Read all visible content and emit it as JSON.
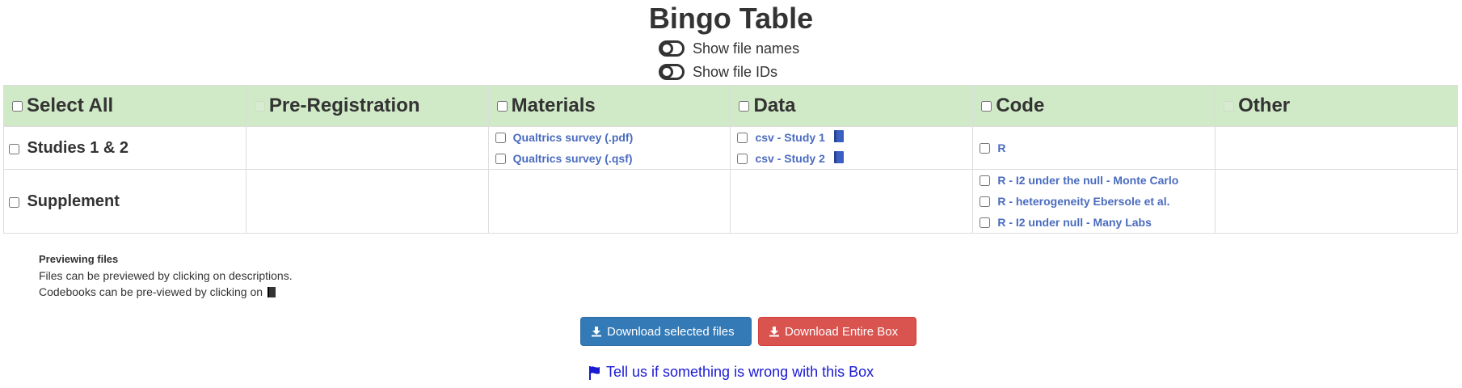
{
  "title": "Bingo Table",
  "toggles": {
    "show_file_names": "Show file names",
    "show_file_ids": "Show file IDs"
  },
  "table": {
    "headers": [
      "Select All",
      "Pre-Registration",
      "Materials",
      "Data",
      "Code",
      "Other"
    ],
    "rows": [
      {
        "label": "Studies 1 & 2",
        "materials": [
          "Qualtrics survey (.pdf)",
          "Qualtrics survey (.qsf)"
        ],
        "data": [
          "csv - Study 1",
          "csv - Study 2"
        ],
        "code": [
          "R"
        ]
      },
      {
        "label": "Supplement",
        "code": [
          "R - I2 under the null - Monte Carlo",
          "R - heterogeneity Ebersole et al.",
          "R - I2 under null - Many Labs"
        ]
      }
    ]
  },
  "preview_note": {
    "title": "Previewing files",
    "line1": "Files can be previewed by clicking on descriptions.",
    "line2": "Codebooks can be pre-viewed by clicking on"
  },
  "buttons": {
    "download_selected": "Download selected files",
    "download_box": "Download Entire Box"
  },
  "report_link": "Tell us if something is wrong with this Box",
  "colors": {
    "header_bg": "#d0e9c6",
    "primary": "#337ab7",
    "danger": "#d9534f",
    "link": "#4a6bbf"
  },
  "icons": {
    "codebook": "book-icon",
    "download": "download-icon",
    "flag": "flag-icon"
  }
}
